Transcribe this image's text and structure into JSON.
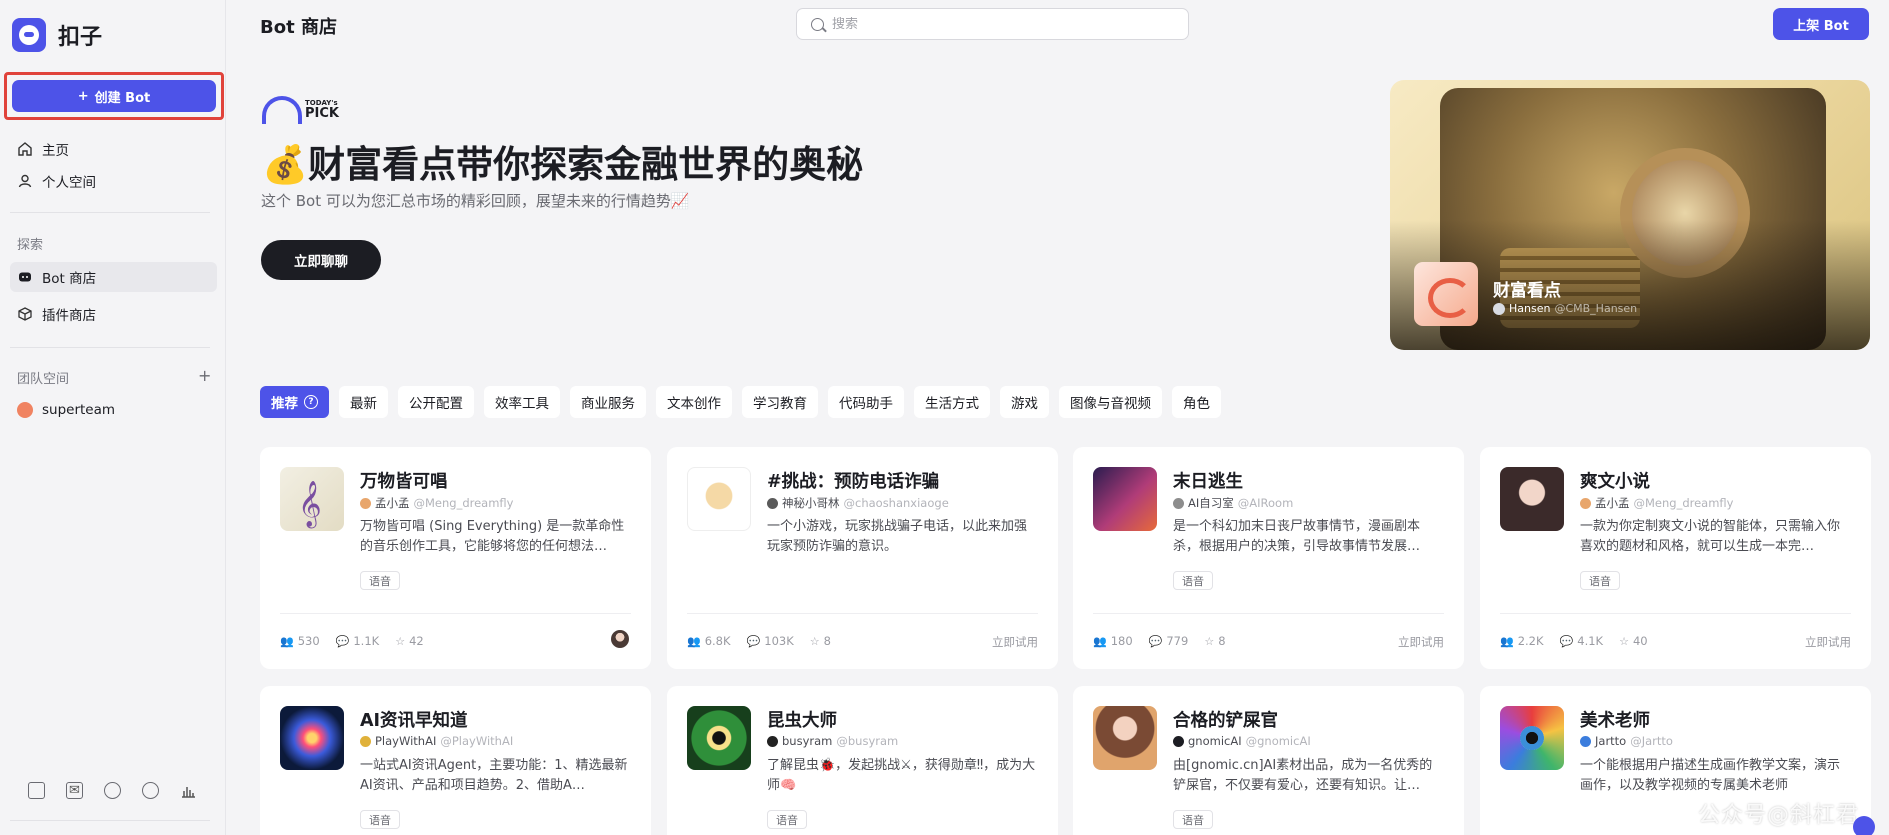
{
  "app": {
    "logo_text": "扣子"
  },
  "sidebar": {
    "create_label": "创建 Bot",
    "nav": [
      {
        "label": "主页",
        "icon": "home-icon"
      },
      {
        "label": "个人空间",
        "icon": "person-icon"
      }
    ],
    "explore_label": "探索",
    "explore": [
      {
        "label": "Bot 商店",
        "icon": "bot-icon",
        "active": true
      },
      {
        "label": "插件商店",
        "icon": "cube-icon"
      }
    ],
    "team_label": "团队空间",
    "team": {
      "name": "superteam"
    },
    "bottom_icons": [
      "document-icon",
      "mail-icon",
      "chat-bubble-icon",
      "discord-icon",
      "chart-icon"
    ]
  },
  "header": {
    "title": "Bot 商店",
    "search_placeholder": "搜索",
    "publish_label": "上架 Bot"
  },
  "hero": {
    "badge_today": "TODAY's",
    "badge_pick": "PICK",
    "title": "💰财富看点带你探索金融世界的奥秘",
    "description": "这个 Bot 可以为您汇总市场的精彩回顾，展望未来的行情趋势📈",
    "chat_label": "立即聊聊",
    "banner": {
      "name": "财富看点",
      "author": "Hansen",
      "handle": "@CMB_Hansen"
    }
  },
  "tabs": [
    {
      "label": "推荐",
      "active": true
    },
    {
      "label": "最新"
    },
    {
      "label": "公开配置"
    },
    {
      "label": "效率工具"
    },
    {
      "label": "商业服务"
    },
    {
      "label": "文本创作"
    },
    {
      "label": "学习教育"
    },
    {
      "label": "代码助手"
    },
    {
      "label": "生活方式"
    },
    {
      "label": "游戏"
    },
    {
      "label": "图像与音视频"
    },
    {
      "label": "角色"
    }
  ],
  "cards": [
    {
      "name": "万物皆可唱",
      "author": "孟小孟",
      "handle": "@Meng_dreamfly",
      "desc": "万物皆可唱 (Sing Everything) 是一款革命性的音乐创作工具，它能够将您的任何想法…",
      "tag": "语音",
      "users": "530",
      "chats": "1.1K",
      "stars": "42",
      "try": ""
    },
    {
      "name": "#挑战：预防电话诈骗",
      "author": "神秘小哥林",
      "handle": "@chaoshanxiaoge",
      "desc": "一个小游戏，玩家挑战骗子电话，以此来加强玩家预防诈骗的意识。",
      "tag": "",
      "users": "6.8K",
      "chats": "103K",
      "stars": "8",
      "try": "立即试用"
    },
    {
      "name": "末日逃生",
      "author": "AI自习室",
      "handle": "@AIRoom",
      "desc": "是一个科幻加末日丧尸故事情节，漫画剧本杀，根据用户的决策，引导故事情节发展…",
      "tag": "语音",
      "users": "180",
      "chats": "779",
      "stars": "8",
      "try": "立即试用"
    },
    {
      "name": "爽文小说",
      "author": "孟小孟",
      "handle": "@Meng_dreamfly",
      "desc": "一款为你定制爽文小说的智能体，只需输入你喜欢的题材和风格，就可以生成一本完…",
      "tag": "语音",
      "users": "2.2K",
      "chats": "4.1K",
      "stars": "40",
      "try": "立即试用"
    },
    {
      "name": "AI资讯早知道",
      "author": "PlayWithAI",
      "handle": "@PlayWithAI",
      "desc": "一站式AI资讯Agent，主要功能：1、精选最新AI资讯、产品和项目趋势。2、借助A…",
      "tag": "语音"
    },
    {
      "name": "昆虫大师",
      "author": "busyram",
      "handle": "@busyram",
      "desc": "了解昆虫🐞，发起挑战⚔，获得勋章‼，成为大师🧠",
      "tag": "语音"
    },
    {
      "name": "合格的铲屎官",
      "author": "gnomicAI",
      "handle": "@gnomicAI",
      "desc": "由[gnomic.cn]AI素材出品，成为一名优秀的铲屎官，不仅要有爱心，还要有知识。让…",
      "tag": "语音"
    },
    {
      "name": "美术老师",
      "author": "Jartto",
      "handle": "@Jartto",
      "desc": "一个能根据用户描述生成画作教学文案，演示画作，以及教学视频的专属美术老师",
      "tag": ""
    }
  ],
  "watermark": "公众号@斜杠君"
}
